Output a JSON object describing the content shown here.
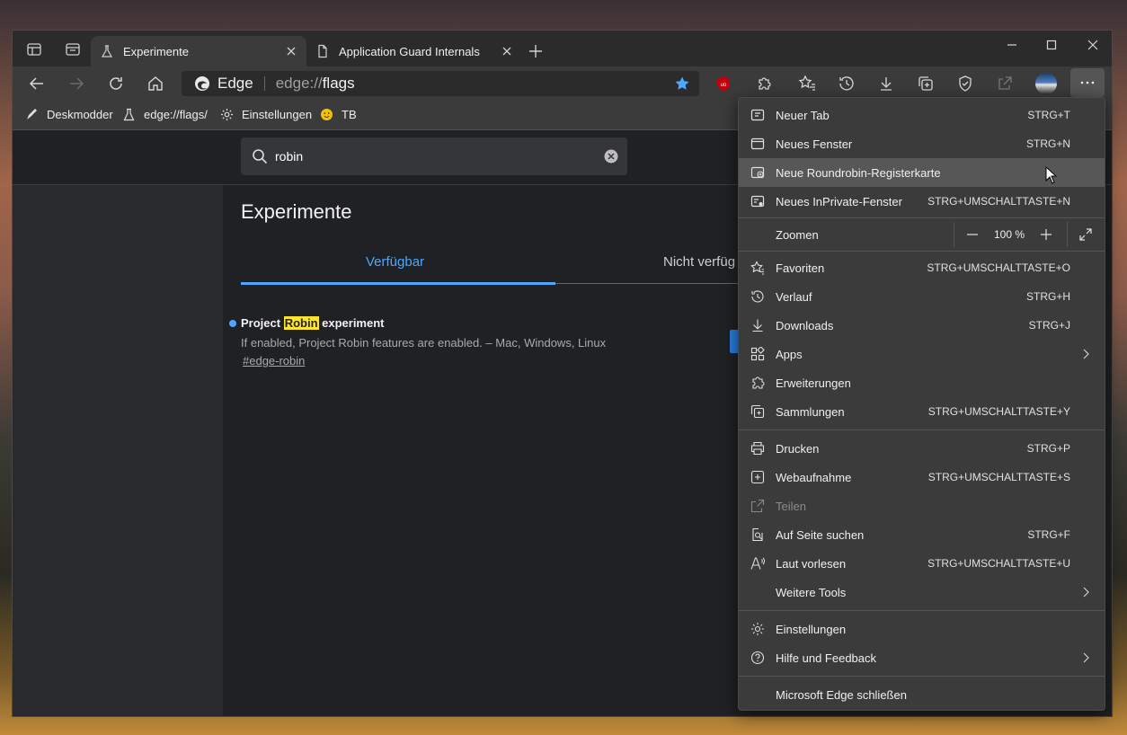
{
  "window": {
    "tabs": [
      {
        "label": "Experimente",
        "active": true,
        "icon": "flask-icon"
      },
      {
        "label": "Application Guard Internals",
        "active": false,
        "icon": "page-icon"
      }
    ]
  },
  "toolbar": {
    "brand": "Edge",
    "url_prefix": "edge://",
    "url_host": "flags"
  },
  "favorites": [
    {
      "label": "Deskmodder",
      "icon": "pen-icon"
    },
    {
      "label": "edge://flags/",
      "icon": "flask-icon"
    },
    {
      "label": "Einstellungen",
      "icon": "gear-icon"
    },
    {
      "label": "TB",
      "icon": "smiley-icon"
    }
  ],
  "page": {
    "search_value": "robin",
    "title": "Experimente",
    "tab_available": "Verfügbar",
    "tab_unavailable": "Nicht verfüg",
    "experiment": {
      "title_before": "Project ",
      "title_highlight": "Robin",
      "title_after": " experiment",
      "description": "If enabled, Project Robin features are enabled. – Mac, Windows, Linux",
      "link": "#edge-robin"
    }
  },
  "menu": {
    "new_tab": {
      "label": "Neuer Tab",
      "shortcut": "STRG+T"
    },
    "new_window": {
      "label": "Neues Fenster",
      "shortcut": "STRG+N"
    },
    "new_roundrobin": {
      "label": "Neue Roundrobin-Registerkarte"
    },
    "new_inprivate": {
      "label": "Neues InPrivate-Fenster",
      "shortcut": "STRG+UMSCHALTTASTE+N"
    },
    "zoom": {
      "label": "Zoomen",
      "value": "100 %"
    },
    "favorites": {
      "label": "Favoriten",
      "shortcut": "STRG+UMSCHALTTASTE+O"
    },
    "history": {
      "label": "Verlauf",
      "shortcut": "STRG+H"
    },
    "downloads": {
      "label": "Downloads",
      "shortcut": "STRG+J"
    },
    "apps": {
      "label": "Apps"
    },
    "extensions": {
      "label": "Erweiterungen"
    },
    "collections": {
      "label": "Sammlungen",
      "shortcut": "STRG+UMSCHALTTASTE+Y"
    },
    "print": {
      "label": "Drucken",
      "shortcut": "STRG+P"
    },
    "web_capture": {
      "label": "Webaufnahme",
      "shortcut": "STRG+UMSCHALTTASTE+S"
    },
    "share": {
      "label": "Teilen"
    },
    "find": {
      "label": "Auf Seite suchen",
      "shortcut": "STRG+F"
    },
    "read_aloud": {
      "label": "Laut vorlesen",
      "shortcut": "STRG+UMSCHALTTASTE+U"
    },
    "more_tools": {
      "label": "Weitere Tools"
    },
    "settings": {
      "label": "Einstellungen"
    },
    "help": {
      "label": "Hilfe und Feedback"
    },
    "close": {
      "label": "Microsoft Edge schließen"
    }
  },
  "colors": {
    "accent": "#4ea6ff",
    "highlight": "#ffe52c",
    "ublock": "#c4000a"
  }
}
